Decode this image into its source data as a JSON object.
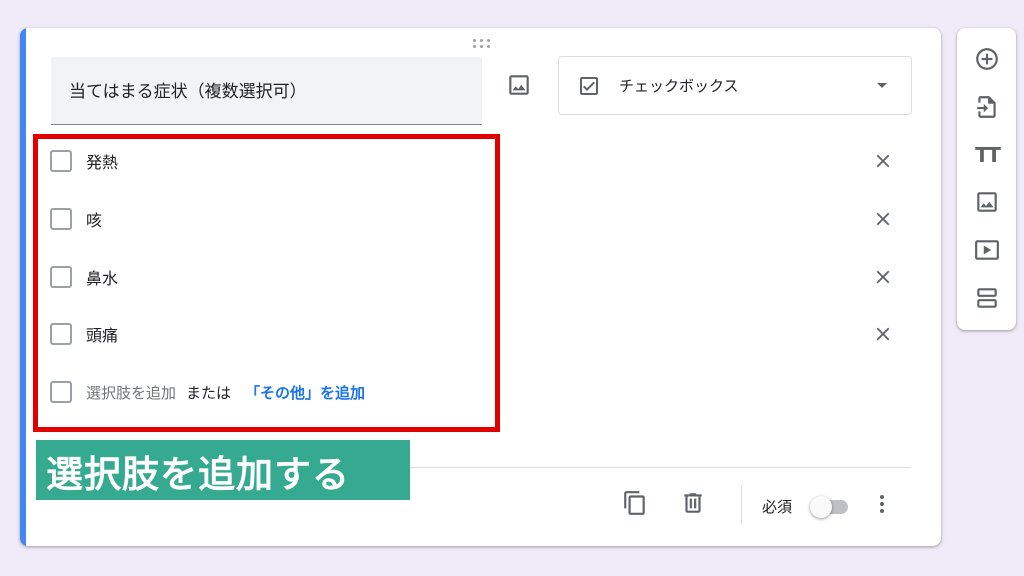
{
  "question": {
    "title": "当てはまる症状（複数選択可）",
    "type_label": "チェックボックス"
  },
  "options": [
    {
      "label": "発熱"
    },
    {
      "label": "咳"
    },
    {
      "label": "鼻水"
    },
    {
      "label": "頭痛"
    }
  ],
  "add_option": {
    "add_label": "選択肢を追加",
    "or_text": "または",
    "add_other_label": "「その他」を追加"
  },
  "footer": {
    "required_label": "必須",
    "required_enabled": false
  },
  "annotation": {
    "text": "選択肢を追加する"
  },
  "side_toolbar": {
    "icons": [
      "add-circle-icon",
      "import-icon",
      "title-text-icon",
      "image-icon",
      "video-icon",
      "section-icon"
    ]
  },
  "colors": {
    "accent": "#4285f4",
    "highlight": "#e00000",
    "annotation_bg": "#35aa91",
    "link": "#1a73e8",
    "background": "#f0ebf8"
  }
}
